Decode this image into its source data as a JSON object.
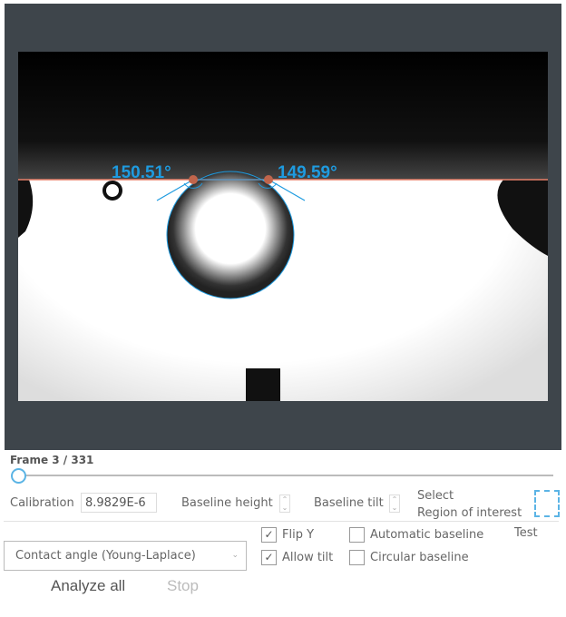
{
  "viewer": {
    "angle_left": "150.51°",
    "angle_right": "149.59°",
    "accent": "#1e9be0",
    "baseline_color": "#e8806a"
  },
  "frame": {
    "label": "Frame 3 / 331",
    "current": 3,
    "total": 331
  },
  "calibration": {
    "label": "Calibration",
    "value": "8.9829E-6"
  },
  "baseline_height": {
    "label": "Baseline height"
  },
  "baseline_tilt": {
    "label": "Baseline tilt"
  },
  "roi": {
    "line1": "Select",
    "line2": "Region of interest"
  },
  "method": {
    "selected": "Contact angle (Young-Laplace)"
  },
  "options": {
    "flip_y": {
      "label": "Flip Y",
      "checked": true
    },
    "allow_tilt": {
      "label": "Allow tilt",
      "checked": true
    },
    "automatic_baseline": {
      "label": "Automatic baseline",
      "checked": false
    },
    "circular_baseline": {
      "label": "Circular baseline",
      "checked": false
    }
  },
  "test_label": "Test",
  "actions": {
    "analyze_all": "Analyze all",
    "stop": "Stop"
  }
}
